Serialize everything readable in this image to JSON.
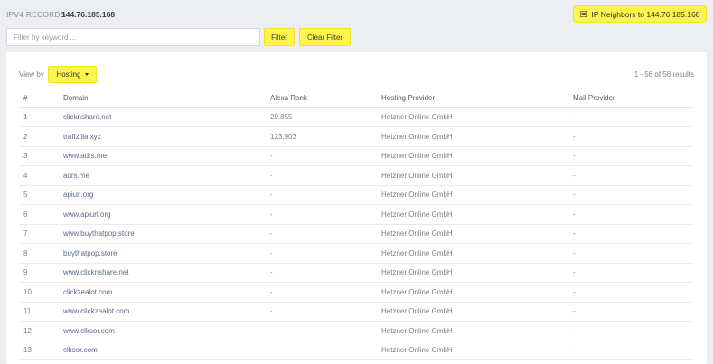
{
  "header": {
    "records_label": "IPV4 RECORDS",
    "ip_value": "144.76.185.168",
    "neighbors_button": "IP Neighbors to 144.76.185.168"
  },
  "filter": {
    "placeholder": "Filter by keyword ...",
    "filter_label": "Filter",
    "clear_label": "Clear Filter"
  },
  "view": {
    "label": "View by",
    "selected": "Hosting",
    "results_text": "1 - 58 of 58 results"
  },
  "table": {
    "columns": [
      "#",
      "Domain",
      "Alexa Rank",
      "Hosting Provider",
      "Mail Provider"
    ],
    "rows": [
      {
        "num": "1",
        "domain": "clicknshare.net",
        "rank": "20.855",
        "host": "Hetzner Online GmbH",
        "mail": "-"
      },
      {
        "num": "2",
        "domain": "traffzilla.xyz",
        "rank": "123.903",
        "host": "Hetzner Online GmbH",
        "mail": "-"
      },
      {
        "num": "3",
        "domain": "www.adrs.me",
        "rank": "-",
        "host": "Hetzner Online GmbH",
        "mail": "-"
      },
      {
        "num": "4",
        "domain": "adrs.me",
        "rank": "-",
        "host": "Hetzner Online GmbH",
        "mail": "-"
      },
      {
        "num": "5",
        "domain": "apiurl.org",
        "rank": "-",
        "host": "Hetzner Online GmbH",
        "mail": "-"
      },
      {
        "num": "6",
        "domain": "www.apiurl.org",
        "rank": "-",
        "host": "Hetzner Online GmbH",
        "mail": "-"
      },
      {
        "num": "7",
        "domain": "www.buythatpop.store",
        "rank": "-",
        "host": "Hetzner Online GmbH",
        "mail": "-"
      },
      {
        "num": "8",
        "domain": "buythatpop.store",
        "rank": "-",
        "host": "Hetzner Online GmbH",
        "mail": "-"
      },
      {
        "num": "9",
        "domain": "www.clicknshare.net",
        "rank": "-",
        "host": "Hetzner Online GmbH",
        "mail": "-"
      },
      {
        "num": "10",
        "domain": "clickzealot.com",
        "rank": "-",
        "host": "Hetzner Online GmbH",
        "mail": "-"
      },
      {
        "num": "11",
        "domain": "www.clickzealot.com",
        "rank": "-",
        "host": "Hetzner Online GmbH",
        "mail": "-"
      },
      {
        "num": "12",
        "domain": "www.clksor.com",
        "rank": "-",
        "host": "Hetzner Online GmbH",
        "mail": "-"
      },
      {
        "num": "13",
        "domain": "clksor.com",
        "rank": "-",
        "host": "Hetzner Online GmbH",
        "mail": "-"
      }
    ]
  }
}
